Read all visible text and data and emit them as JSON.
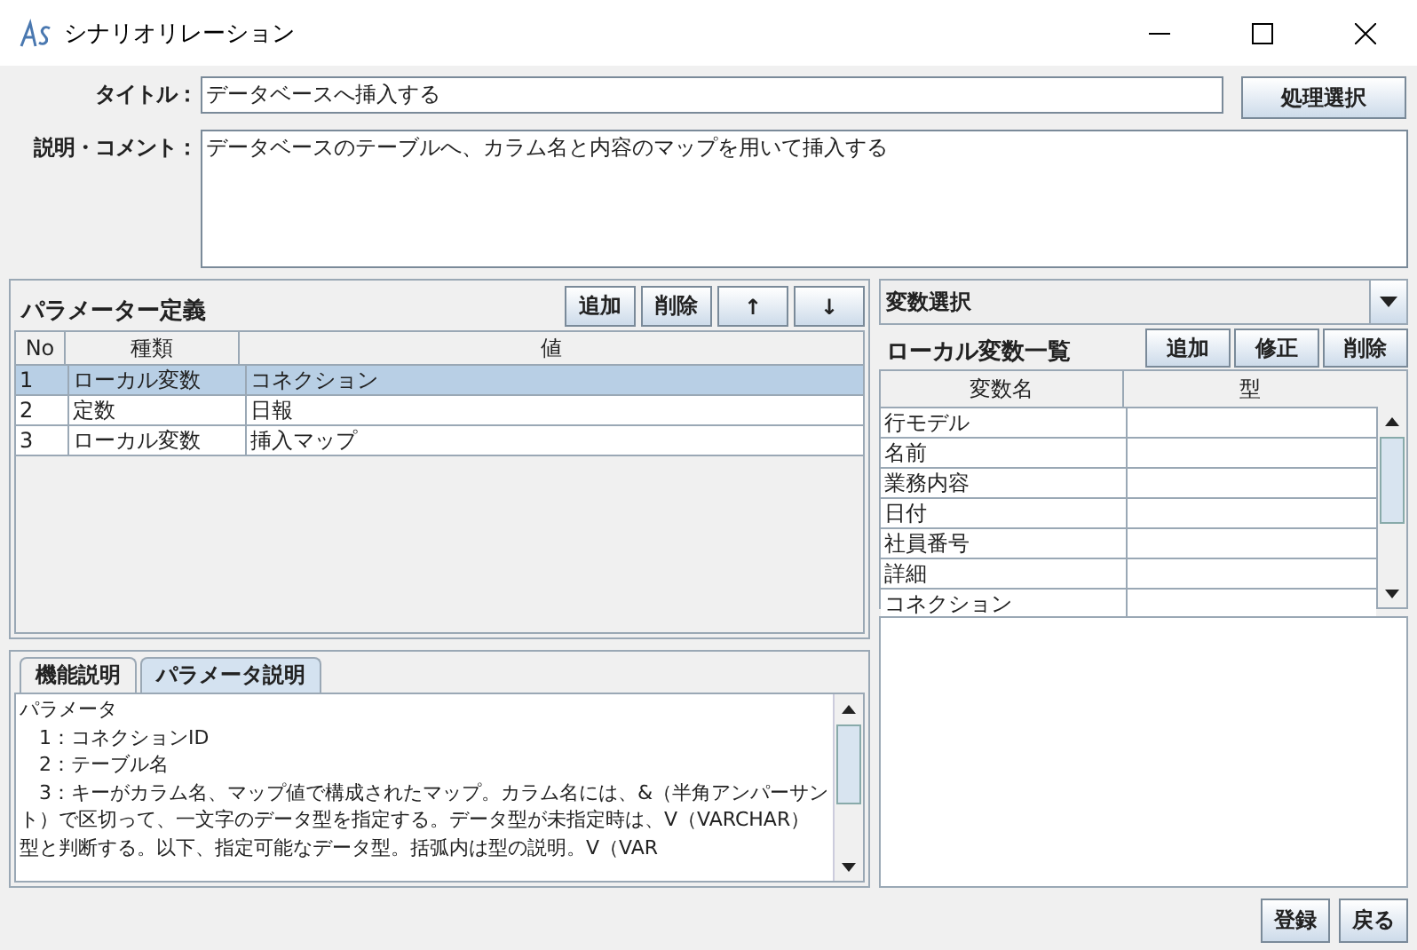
{
  "window": {
    "title": "シナリオリレーション"
  },
  "form": {
    "title_label": "タイトル：",
    "title_value": "データベースへ挿入する",
    "select_button": "処理選択",
    "description_label": "説明・コメント：",
    "description_value": "データベースのテーブルへ、カラム名と内容のマップを用いて挿入する"
  },
  "parameters": {
    "title": "パラメーター定義",
    "buttons": [
      "追加",
      "削除",
      "↑",
      "↓"
    ],
    "columns": [
      "No",
      "種類",
      "値"
    ],
    "rows": [
      {
        "no": "1",
        "type": "ローカル変数",
        "value": "コネクション",
        "selected": true
      },
      {
        "no": "2",
        "type": "定数",
        "value": "日報",
        "selected": false
      },
      {
        "no": "3",
        "type": "ローカル変数",
        "value": "挿入マップ",
        "selected": false
      }
    ]
  },
  "help_tabs": [
    {
      "label": "機能説明",
      "selected": false
    },
    {
      "label": "パラメータ説明",
      "selected": true
    }
  ],
  "help_text": [
    "パラメータ",
    "　1：コネクションID",
    "　2：テーブル名",
    "　3：キーがカラム名、マップ値で構成されたマップ。カラム名には、&（半角アンパーサント）で区切って、一文字のデータ型を指定する。データ型が未指定時は、V（VARCHAR）型と判断する。以下、指定可能なデータ型。括弧内は型の説明。V（VAR"
  ],
  "variables": {
    "selector_value": "変数選択",
    "title": "ローカル変数一覧",
    "buttons": [
      "追加",
      "修正",
      "削除"
    ],
    "columns": [
      "変数名",
      "型"
    ],
    "rows": [
      {
        "name": "行モデル"
      },
      {
        "name": "名前"
      },
      {
        "name": "業務内容"
      },
      {
        "name": "日付"
      },
      {
        "name": "社員番号"
      },
      {
        "name": "詳細"
      },
      {
        "name": "コネクション"
      }
    ]
  },
  "footer_buttons": [
    "登録",
    "戻る"
  ]
}
